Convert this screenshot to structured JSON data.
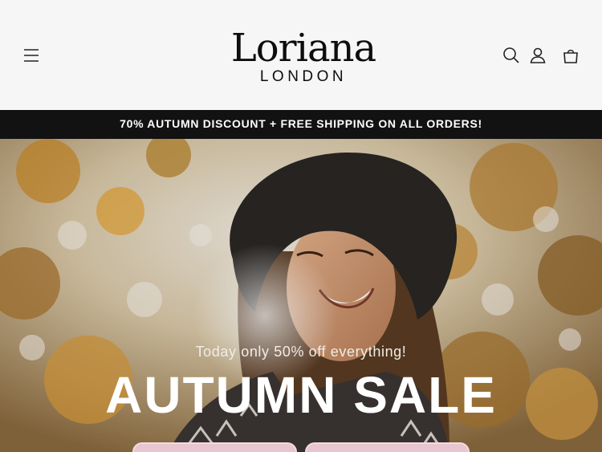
{
  "header": {
    "logo_main": "Loriana",
    "logo_sub": "LONDON",
    "icons": [
      "menu-icon",
      "search-icon",
      "account-icon",
      "cart-icon"
    ]
  },
  "announcement": {
    "text": "70% AUTUMN DISCOUNT + FREE SHIPPING ON ALL ORDERS!"
  },
  "hero": {
    "subtitle": "Today only 50% off everything!",
    "title": "AUTUMN SALE",
    "buttons": [
      "",
      ""
    ]
  },
  "colors": {
    "background": "#f6f6f6",
    "announcement_bg": "#121212",
    "button_pink": "#e8c6d0"
  }
}
